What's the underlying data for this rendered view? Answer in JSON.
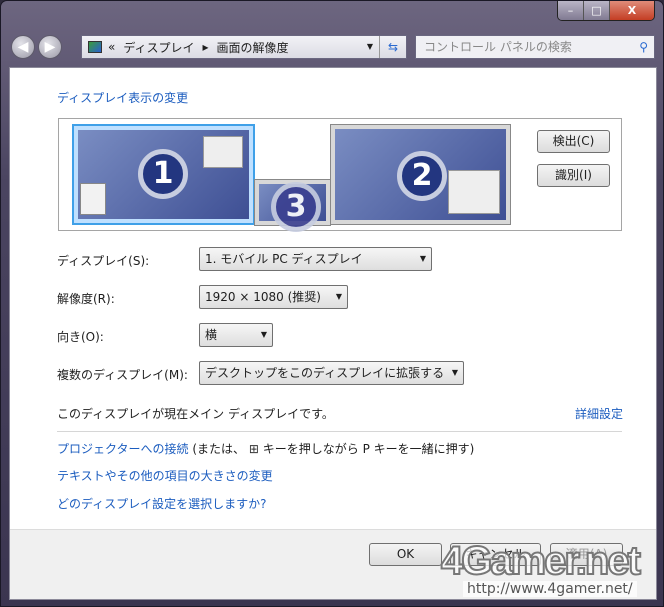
{
  "titlebar": {
    "min": "–",
    "max": "□",
    "close": "X"
  },
  "nav": {
    "back": "◀",
    "forward": "▶",
    "breadcrumb_sep": "«",
    "crumb1": "ディスプレイ",
    "arrow": "▸",
    "crumb2": "画面の解像度",
    "search_placeholder": "コントロール パネルの検索"
  },
  "main": {
    "heading": "ディスプレイ表示の変更",
    "monitors": [
      {
        "number": "1"
      },
      {
        "number": "2"
      },
      {
        "number": "3"
      }
    ],
    "detect": "検出(C)",
    "identify": "識別(I)",
    "rows": [
      {
        "label": "ディスプレイ(S):",
        "value": "1. モバイル PC ディスプレイ"
      },
      {
        "label": "解像度(R):",
        "value": "1920 × 1080 (推奨)"
      },
      {
        "label": "向き(O):",
        "value": "横"
      },
      {
        "label": "複数のディスプレイ(M):",
        "value": "デスクトップをこのディスプレイに拡張する"
      }
    ],
    "main_display_text": "このディスプレイが現在メイン ディスプレイです。",
    "advanced": "詳細設定",
    "projector_link": "プロジェクターへの接続",
    "projector_hint": "(または、",
    "projector_hint2": "キーを押しながら P キーを一緒に押す)",
    "text_size_link": "テキストやその他の項目の大きさの変更",
    "which_link": "どのディスプレイ設定を選択しますか?"
  },
  "footer": {
    "ok": "OK",
    "cancel": "キャンセル",
    "apply": "適用(A)"
  },
  "watermark": {
    "logo": "4Gamer.net",
    "url": "http://www.4gamer.net/"
  }
}
